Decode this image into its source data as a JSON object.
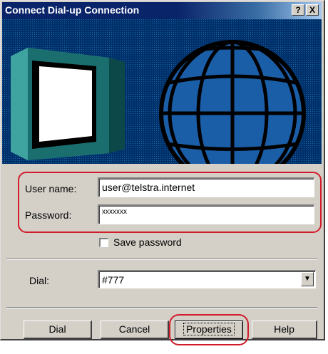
{
  "window": {
    "title": "Connect Dial-up Connection",
    "help_button": "?",
    "close_button": "X"
  },
  "form": {
    "username_label": "User name:",
    "username_value": "user@telstra.internet",
    "password_label": "Password:",
    "password_value": "xxxxxxx",
    "save_password_label": "Save password",
    "save_password_checked": false,
    "dial_label": "Dial:",
    "dial_value": "#777"
  },
  "buttons": {
    "dial": "Dial",
    "cancel": "Cancel",
    "properties": "Properties",
    "help": "Help"
  },
  "colors": {
    "titlebar": "#0a246a",
    "dialog_face": "#d4d0c8",
    "highlight_ring": "#d21c2c",
    "globe": "#1b5ea8"
  }
}
